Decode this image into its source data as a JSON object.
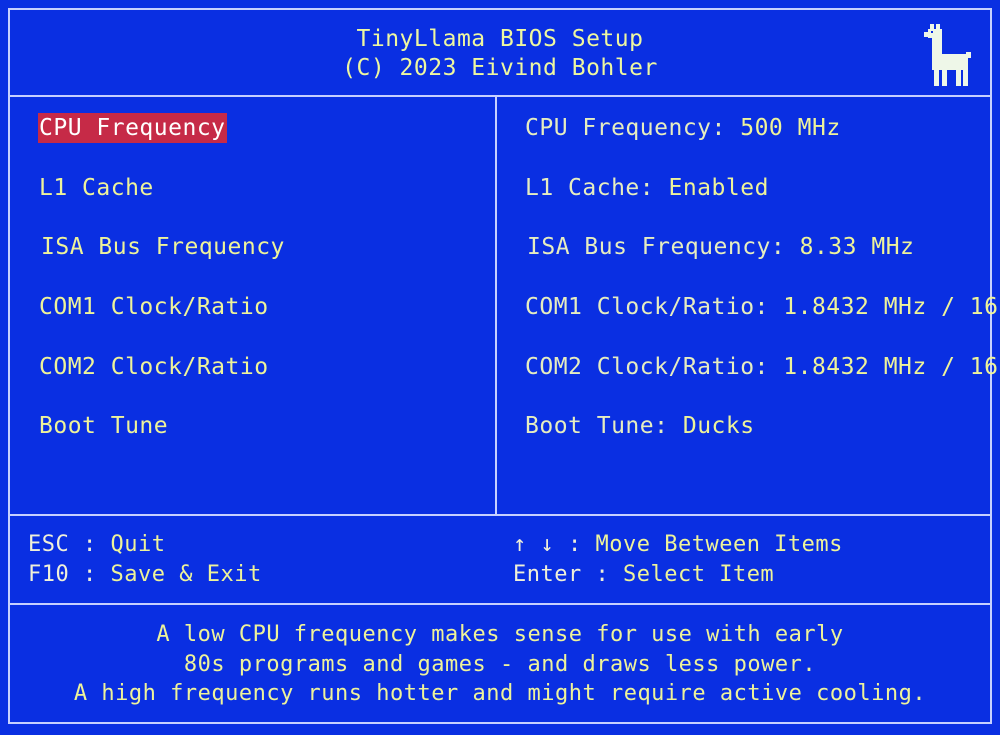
{
  "header": {
    "title": "TinyLlama BIOS Setup",
    "copyright": "(C) 2023 Eivind Bohler",
    "logo_icon": "llama-icon"
  },
  "colors": {
    "background": "#0a2fe2",
    "frame": "#c7d0ff",
    "text": "#eef39a",
    "selection": "#c62a47"
  },
  "menu": {
    "items": [
      {
        "label": "CPU Frequency",
        "selected": true
      },
      {
        "label": "L1 Cache",
        "selected": false
      },
      {
        "label": "ISA Bus Frequency",
        "selected": false
      },
      {
        "label": "COM1 Clock/Ratio",
        "selected": false
      },
      {
        "label": "COM2 Clock/Ratio",
        "selected": false
      },
      {
        "label": "Boot Tune",
        "selected": false
      }
    ]
  },
  "values": {
    "items": [
      {
        "label": "CPU Frequency:",
        "value": "500 MHz"
      },
      {
        "label": "L1 Cache:",
        "value": "Enabled"
      },
      {
        "label": "ISA Bus Frequency:",
        "value": "8.33 MHz"
      },
      {
        "label": "COM1 Clock/Ratio:",
        "value": "1.8432 MHz / 16"
      },
      {
        "label": "COM2 Clock/Ratio:",
        "value": "1.8432 MHz / 16"
      },
      {
        "label": "Boot Tune:",
        "value": "Ducks"
      }
    ]
  },
  "keys": {
    "esc_key": "ESC",
    "esc_desc": "Quit",
    "f10_key": "F10",
    "f10_desc": "Save & Exit",
    "arrows_key": "↑ ↓",
    "arrows_desc": "Move Between Items",
    "enter_key": "Enter",
    "enter_desc": "Select Item",
    "separator": ":"
  },
  "help": {
    "line1": "A low CPU frequency makes sense for use with early",
    "line2": "80s programs and games - and draws less power.",
    "line3": "A high frequency runs hotter and might require active cooling."
  }
}
